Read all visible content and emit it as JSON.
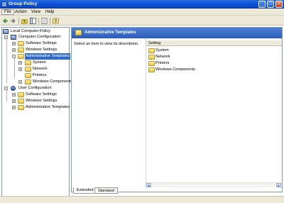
{
  "window": {
    "title": "Group Policy",
    "controls": {
      "minimize": "_",
      "maximize": "□",
      "close": "×"
    }
  },
  "menu": [
    "File",
    "Action",
    "View",
    "Help"
  ],
  "toolbar": {
    "buttons": [
      "back-icon",
      "forward-icon",
      "up-folder-icon",
      "show-hide-tree-icon",
      "properties-icon",
      "help-icon"
    ]
  },
  "tree": {
    "root": "Local Computer Policy",
    "computer": {
      "label": "Computer Configuration",
      "children": [
        "Software Settings",
        "Windows Settings",
        "Administrative Templates"
      ],
      "admin_children": [
        "System",
        "Network",
        "Printers",
        "Windows Components"
      ]
    },
    "user": {
      "label": "User Configuration",
      "children": [
        "Software Settings",
        "Windows Settings",
        "Administrative Templates"
      ]
    },
    "expander_collapsed": "+",
    "expander_expanded": "−"
  },
  "content": {
    "title": "Administrative Templates",
    "description": "Select an item to view its description.",
    "column": "Setting",
    "items": [
      "System",
      "Network",
      "Printers",
      "Windows Components"
    ]
  },
  "tabs": [
    "Extended",
    "Standard"
  ],
  "scroll": {
    "left": "◂",
    "right": "▸"
  },
  "colors": {
    "title_bar": "#0b4fd6",
    "selection": "#316ac5",
    "header": "#2a5cb8",
    "folder": "#e9c547"
  }
}
